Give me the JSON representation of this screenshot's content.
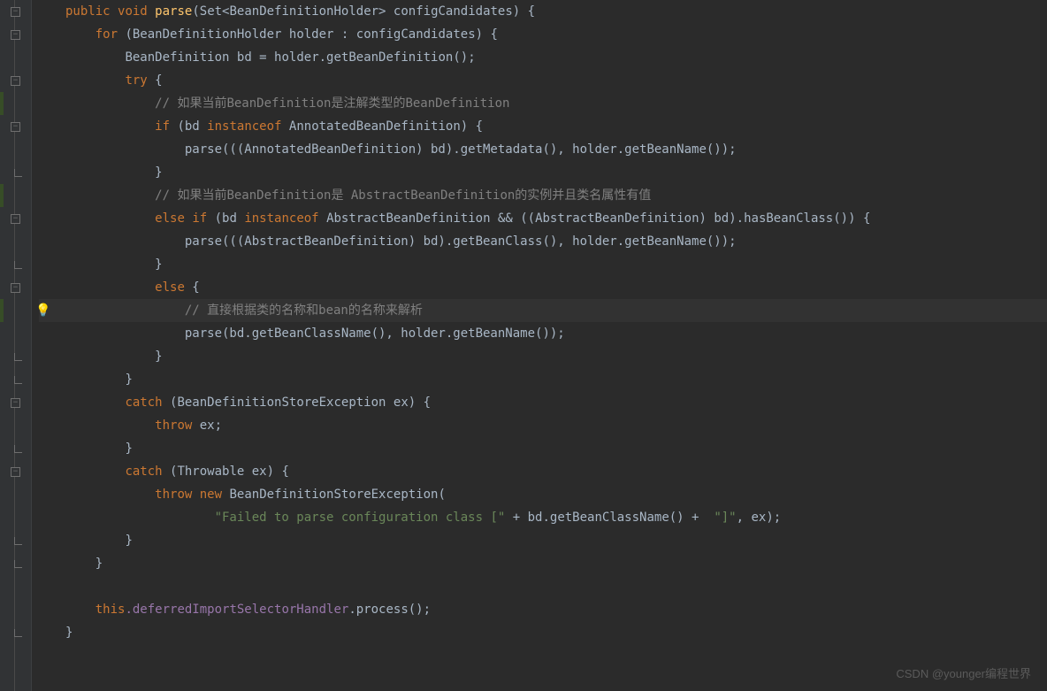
{
  "watermark": "CSDN @younger编程世界",
  "code": {
    "l1": {
      "kw_public": "public",
      "kw_void": "void",
      "method": "parse",
      "type": "Set<BeanDefinitionHolder>",
      "param": "configCandidates"
    },
    "l2": {
      "kw_for": "for",
      "type": "BeanDefinitionHolder",
      "var": "holder",
      "param": "configCandidates"
    },
    "l3": {
      "type": "BeanDefinition",
      "var": "bd",
      "call": "holder.getBeanDefinition()"
    },
    "l4": {
      "kw_try": "try"
    },
    "l5": {
      "comment": "// 如果当前BeanDefinition是注解类型的BeanDefinition"
    },
    "l6": {
      "kw_if": "if",
      "var": "bd",
      "kw_instanceof": "instanceof",
      "type": "AnnotatedBeanDefinition"
    },
    "l7": {
      "call1": "parse(((AnnotatedBeanDefinition) bd).getMetadata(), holder.getBeanName());"
    },
    "l8": {
      "brace": "}"
    },
    "l9": {
      "comment": "// 如果当前BeanDefinition是 AbstractBeanDefinition的实例并且类名属性有值"
    },
    "l10": {
      "kw_else": "else",
      "kw_if": "if",
      "var": "bd",
      "kw_instanceof": "instanceof",
      "type": "AbstractBeanDefinition",
      "cast": "((AbstractBeanDefinition) bd)",
      "call": ".hasBeanClass()"
    },
    "l11": {
      "call": "parse(((AbstractBeanDefinition) bd).getBeanClass(), holder.getBeanName());"
    },
    "l12": {
      "brace": "}"
    },
    "l13": {
      "kw_else": "else"
    },
    "l14": {
      "comment": "// 直接根据类的名称和bean的名称来解析"
    },
    "l15": {
      "call": "parse(bd.getBeanClassName(), holder.getBeanName());"
    },
    "l16": {
      "brace": "}"
    },
    "l17": {
      "brace": "}"
    },
    "l18": {
      "kw_catch": "catch",
      "type": "BeanDefinitionStoreException",
      "var": "ex"
    },
    "l19": {
      "kw_throw": "throw",
      "var": "ex"
    },
    "l20": {
      "brace": "}"
    },
    "l21": {
      "kw_catch": "catch",
      "type": "Throwable",
      "var": "ex"
    },
    "l22": {
      "kw_throw": "throw",
      "kw_new": "new",
      "type": "BeanDefinitionStoreException"
    },
    "l23": {
      "str1": "\"Failed to parse configuration class [\"",
      "mid": " + bd.getBeanClassName() + ",
      "str2": "\"]\"",
      "tail": ", ex);"
    },
    "l24": {
      "brace": "}"
    },
    "l25": {
      "brace": "}"
    },
    "l27": {
      "kw_this": "this",
      "field": ".deferredImportSelectorHandler",
      "call": ".process();"
    },
    "l28": {
      "brace": "}"
    }
  }
}
